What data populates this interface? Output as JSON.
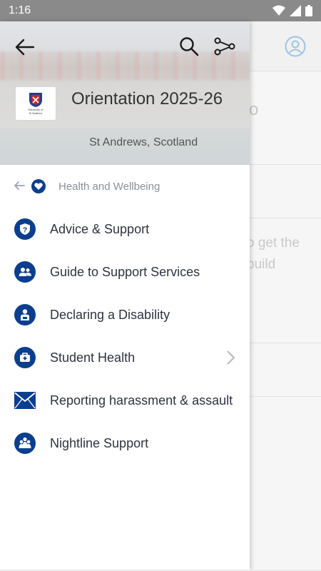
{
  "status_bar": {
    "time": "1:16"
  },
  "drawer": {
    "title": "Orientation 2025-26",
    "subtitle": "St Andrews, Scotland",
    "logo_text": [
      "University of",
      "St Andrews"
    ],
    "breadcrumb": "Health and Wellbeing",
    "items": [
      {
        "label": "Advice & Support",
        "icon": "shield-question-icon"
      },
      {
        "label": "Guide to Support Services",
        "icon": "people-icon"
      },
      {
        "label": "Declaring a Disability",
        "icon": "person-badge-icon"
      },
      {
        "label": "Student Health",
        "icon": "medical-bag-icon",
        "has_children": true
      },
      {
        "label": "Reporting harassment & assault",
        "icon": "envelope-icon"
      },
      {
        "label": "Nightline Support",
        "icon": "group-icon"
      }
    ]
  },
  "background_page": {
    "partial_heading": "o",
    "partial_text_line1": "o get the",
    "partial_text_line2": "build"
  },
  "colors": {
    "accent": "#0b3e8f",
    "status_bar": "#8a8a8a",
    "text_primary": "#2f3340",
    "text_muted": "#8a8f99"
  }
}
